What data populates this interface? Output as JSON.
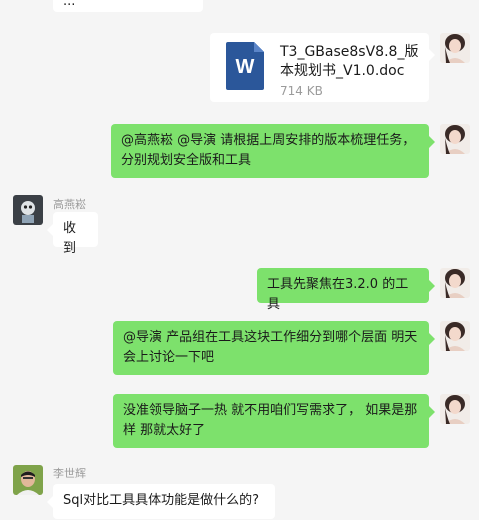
{
  "messages": {
    "top_partial": "...",
    "file": {
      "name": "T3_GBase8sV8.8_版本规划书_V1.0.doc",
      "name_line1": "T3_GBase8sV8.8_版",
      "name_line2": "本规划书_V1.0.doc",
      "size": "714 KB",
      "icon_letter": "W"
    },
    "msg1": {
      "line1": "@高燕崧 @导演  请根据上周安排的版本梳理任务，",
      "line2": "分别规划安全版和工具"
    },
    "msg2": {
      "sender": "高燕崧",
      "text": "收到"
    },
    "msg3": {
      "text": "工具先聚焦在3.2.0 的工具"
    },
    "msg4": {
      "line1": "@导演 产品组在工具这块工作细分到哪个层面 明天",
      "line2": "会上讨论一下吧"
    },
    "msg5": {
      "line1": "没准领导脑子一热 就不用咱们写需求了， 如果是那",
      "line2": "样 那就太好了"
    },
    "msg6": {
      "sender": "李世辉",
      "text": "Sql对比工具具体功能是做什么的?"
    }
  },
  "colors": {
    "self_bubble": "#7de16c",
    "other_bubble": "#ffffff",
    "background": "#f5f5f5",
    "word_icon": "#2b579a"
  }
}
